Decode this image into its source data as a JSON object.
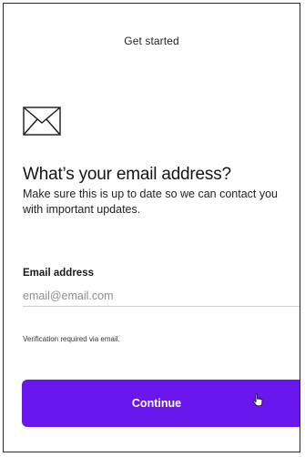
{
  "header": {
    "title": "Get started"
  },
  "envelope_icon": "envelope-icon",
  "main": {
    "heading": "What’s your email address?",
    "subtext": "Make sure this is up to date so we can contact you with important updates."
  },
  "email_field": {
    "label": "Email address",
    "value": "",
    "placeholder": "email@email.com"
  },
  "helper_text": "Verification required via email.",
  "continue_button": {
    "label": "Continue"
  },
  "cursor_icon": "hand-pointer-icon",
  "colors": {
    "accent": "#6a17ee",
    "button_text": "#ffffff",
    "placeholder": "#8d8d8d",
    "divider": "#cfcfcf"
  }
}
